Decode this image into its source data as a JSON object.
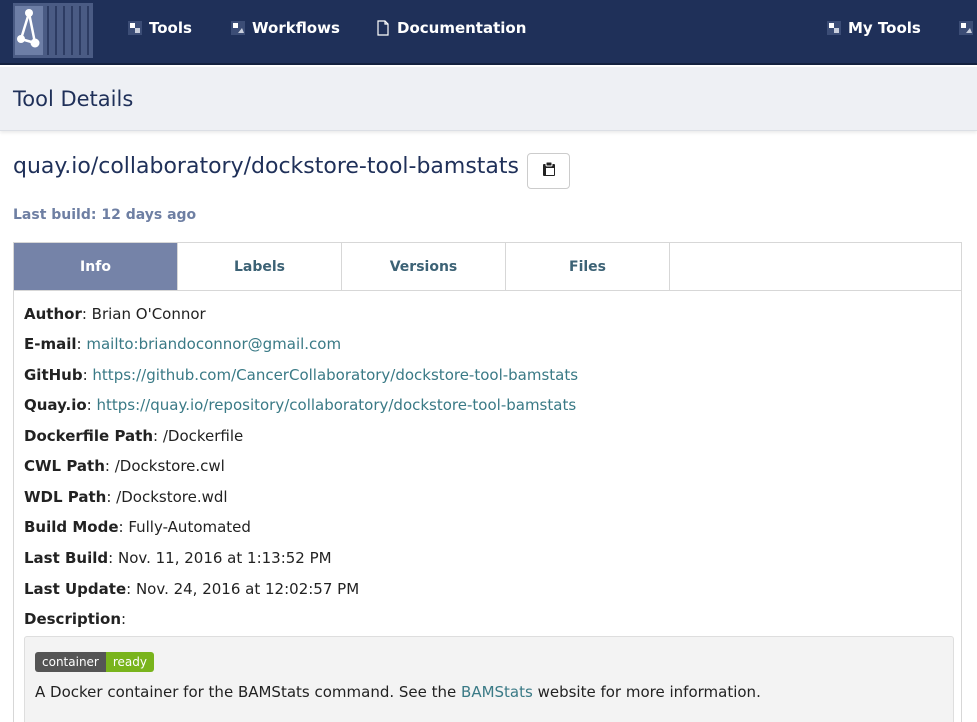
{
  "nav": {
    "tools": "Tools",
    "workflows": "Workflows",
    "documentation": "Documentation",
    "my_tools": "My Tools"
  },
  "header": {
    "title": "Tool Details"
  },
  "tool": {
    "path": "quay.io/collaboratory/dockstore-tool-bamstats",
    "last_build": "Last build: 12 days ago"
  },
  "tabs": [
    "Info",
    "Labels",
    "Versions",
    "Files"
  ],
  "info": {
    "author_label": "Author",
    "author": "Brian O'Connor",
    "email_label": "E-mail",
    "email": "mailto:briandoconnor@gmail.com",
    "github_label": "GitHub",
    "github": "https://github.com/CancerCollaboratory/dockstore-tool-bamstats",
    "quay_label": "Quay.io",
    "quay": "https://quay.io/repository/collaboratory/dockstore-tool-bamstats",
    "dockerfile_label": "Dockerfile Path",
    "dockerfile": "/Dockerfile",
    "cwl_label": "CWL Path",
    "cwl": "/Dockstore.cwl",
    "wdl_label": "WDL Path",
    "wdl": "/Dockstore.wdl",
    "buildmode_label": "Build Mode",
    "buildmode": "Fully-Automated",
    "lastbuild_label": "Last Build",
    "lastbuild": "Nov. 11, 2016 at 1:13:52 PM",
    "lastupdate_label": "Last Update",
    "lastupdate": "Nov. 24, 2016 at 12:02:57 PM",
    "description_label": "Description"
  },
  "description": {
    "badge_left": "container",
    "badge_right": "ready",
    "text_before": "A Docker container for the BAMStats command. See the ",
    "link": "BAMStats",
    "text_after": " website for more information."
  },
  "colors": {
    "navbar": "#1f3059",
    "active_tab": "#7583a8",
    "link": "#3a7a86",
    "badge_ready": "#79b41c"
  },
  "icons": [
    "dockstore-logo-icon",
    "tools-icon",
    "workflows-icon",
    "document-icon",
    "my-tools-icon",
    "my-workflows-icon",
    "clipboard-icon"
  ]
}
